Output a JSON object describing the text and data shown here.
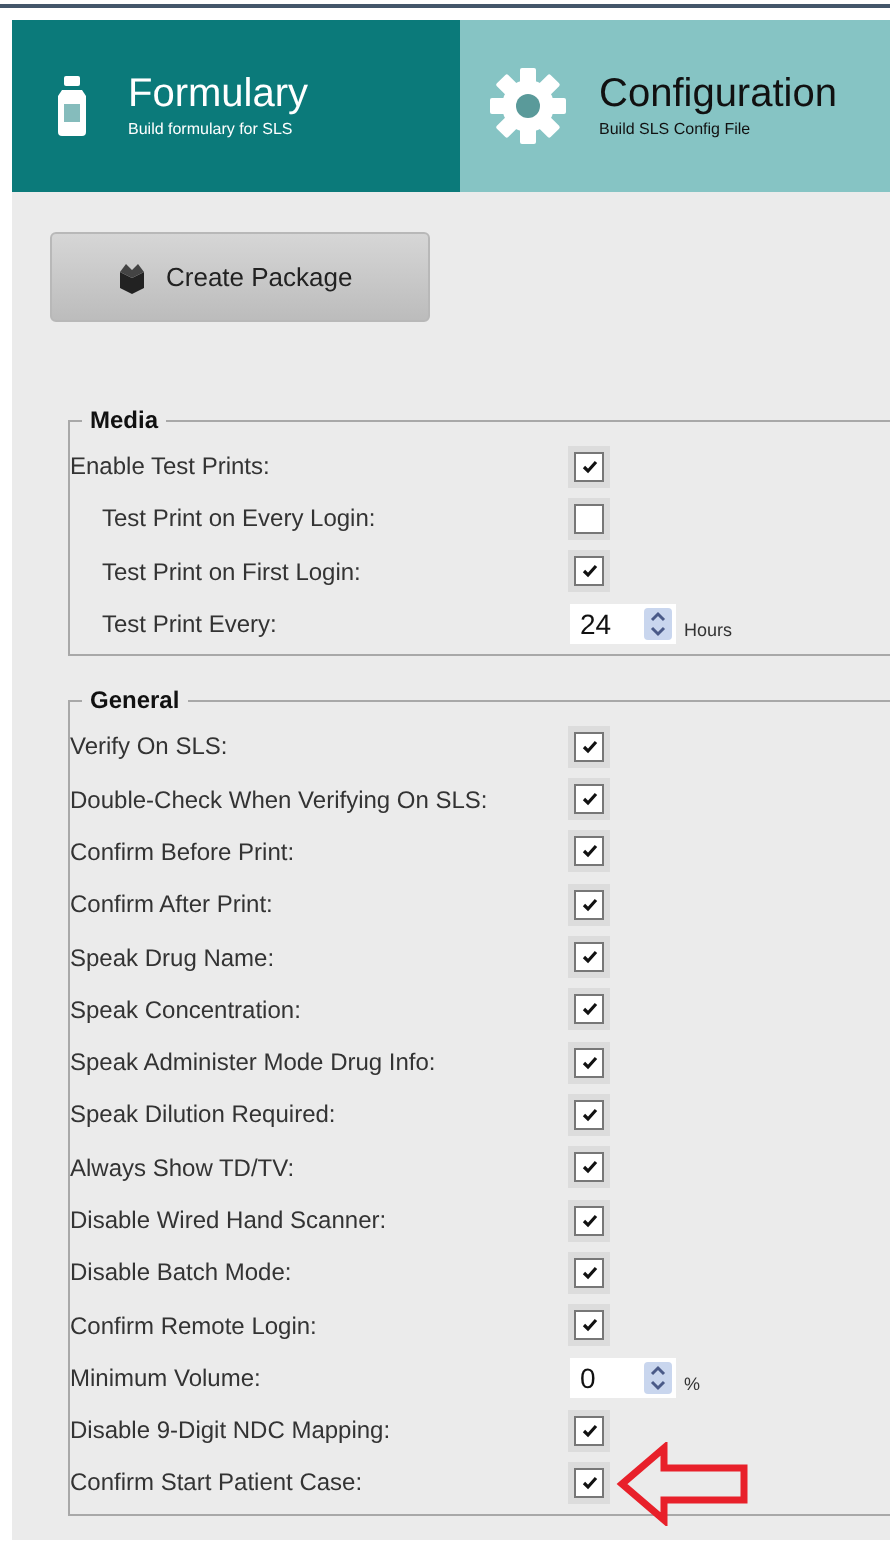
{
  "tabs": [
    {
      "kind": "bottle",
      "title": "Formulary",
      "subtitle": "Build formulary for SLS",
      "selected": false
    },
    {
      "kind": "gear",
      "title": "Configuration",
      "subtitle": "Build SLS Config File",
      "selected": true
    }
  ],
  "create_button": {
    "label": "Create Package"
  },
  "sections": [
    {
      "legend": "Media",
      "rows": [
        {
          "kind": "checkbox",
          "label": "Enable Test Prints:",
          "checked": true,
          "children": [
            {
              "kind": "checkbox",
              "label": "Test Print on Every Login:",
              "checked": false
            },
            {
              "kind": "checkbox",
              "label": "Test Print on First Login:",
              "checked": true
            },
            {
              "kind": "number",
              "label": "Test Print Every:",
              "value": "24",
              "unit": "Hours"
            }
          ]
        }
      ]
    },
    {
      "legend": "General",
      "rows": [
        {
          "kind": "checkbox",
          "label": "Verify On SLS:",
          "checked": true
        },
        {
          "kind": "checkbox",
          "label": "Double-Check When Verifying On SLS:",
          "checked": true
        },
        {
          "kind": "checkbox",
          "label": "Confirm Before Print:",
          "checked": true
        },
        {
          "kind": "checkbox",
          "label": "Confirm After Print:",
          "checked": true
        },
        {
          "kind": "checkbox",
          "label": "Speak Drug Name:",
          "checked": true
        },
        {
          "kind": "checkbox",
          "label": "Speak Concentration:",
          "checked": true
        },
        {
          "kind": "checkbox",
          "label": "Speak Administer Mode Drug Info:",
          "checked": true
        },
        {
          "kind": "checkbox",
          "label": "Speak Dilution Required:",
          "checked": true
        },
        {
          "kind": "checkbox",
          "label": "Always Show TD/TV:",
          "checked": true
        },
        {
          "kind": "checkbox",
          "label": "Disable Wired Hand Scanner:",
          "checked": true
        },
        {
          "kind": "checkbox",
          "label": "Disable Batch Mode:",
          "checked": true
        },
        {
          "kind": "checkbox",
          "label": "Confirm Remote Login:",
          "checked": true
        },
        {
          "kind": "number",
          "label": "Minimum Volume:",
          "value": "0",
          "unit": "%"
        },
        {
          "kind": "checkbox",
          "label": "Disable 9-Digit NDC Mapping:",
          "checked": true
        },
        {
          "kind": "checkbox",
          "label": "Confirm Start Patient Case:",
          "checked": true,
          "highlighted": true
        }
      ]
    }
  ]
}
